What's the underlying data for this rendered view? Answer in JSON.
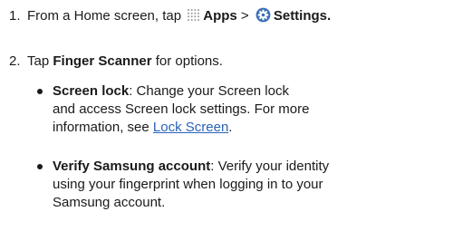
{
  "steps": [
    {
      "number": "1.",
      "prefix": "From a Home screen, tap",
      "apps_label": "Apps",
      "separator": ">",
      "settings_label": "Settings",
      "suffix": "."
    },
    {
      "number": "2.",
      "prefix": "Tap",
      "bold": "Finger Scanner",
      "suffix": "for options."
    }
  ],
  "bullets": [
    {
      "title": "Screen lock",
      "line1": ": Change your Screen lock",
      "line2": "and access Screen lock settings. For more",
      "line3_prefix": "information, see",
      "link": "Lock Screen",
      "line3_suffix": "."
    },
    {
      "title": "Verify Samsung account",
      "line1": ": Verify your identity",
      "line2": "using your fingerprint when logging in to your",
      "line3": "Samsung account."
    }
  ],
  "icons": {
    "apps": "apps-grid-icon",
    "settings": "settings-gear-icon"
  },
  "colors": {
    "text": "#1a1a1a",
    "link": "#2a63b7",
    "settings_icon": "#3b6fb6"
  }
}
